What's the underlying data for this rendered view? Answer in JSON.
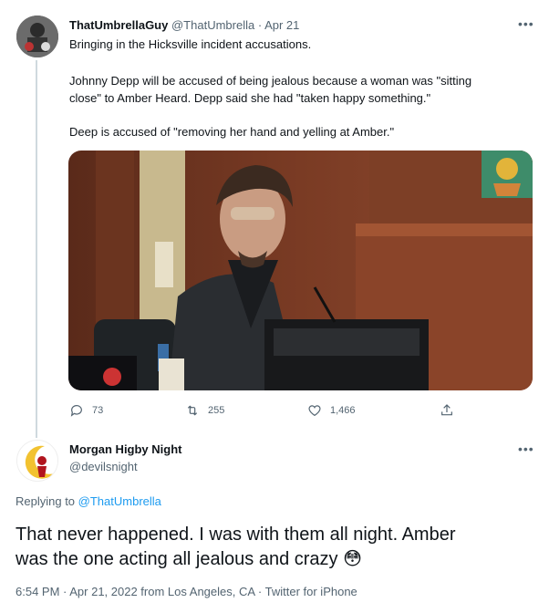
{
  "tweet1": {
    "display_name": "ThatUmbrellaGuy",
    "handle": "@ThatUmbrella",
    "separator": "·",
    "date": "Apr 21",
    "text_lines": [
      "Bringing in the Hicksville incident accusations.",
      "Johnny Depp will be accused of being jealous because a woman was \"sitting",
      "close\" to Amber Heard. Depp said she had \"taken happy something.\"",
      "Deep is accused of \"removing her hand and yelling at Amber.\""
    ],
    "replies": "73",
    "retweets": "255",
    "likes": "1,466"
  },
  "tweet2": {
    "display_name": "Morgan Higby Night",
    "handle": "@devilsnight",
    "replying_prefix": "Replying to",
    "replying_to": "@ThatUmbrella",
    "text_line1": "That never happened. I was with them all night. Amber",
    "text_line2": "was the one acting all jealous and crazy",
    "emoji": "😳",
    "timestamp": "6:54 PM · Apr 21, 2022 from Los Angeles, CA · Twitter for iPhone"
  },
  "colors": {
    "text": "#0f1419",
    "muted": "#536471",
    "link": "#1d9bf0",
    "divider": "#eff3f4"
  },
  "icons": [
    "reply-icon",
    "retweet-icon",
    "like-icon",
    "share-icon",
    "more-icon"
  ]
}
